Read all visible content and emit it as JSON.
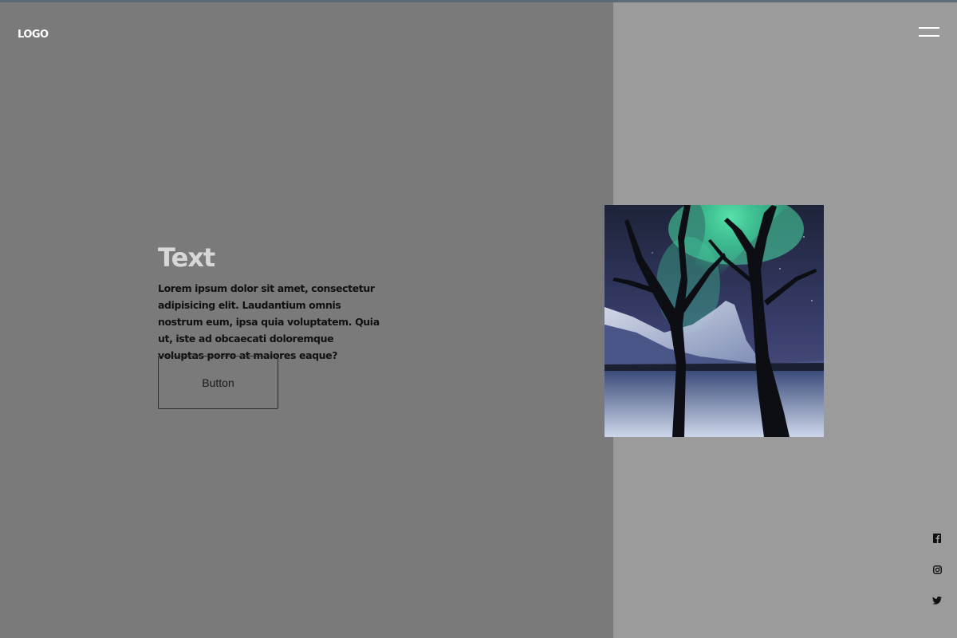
{
  "header": {
    "logo": "LOGO",
    "menu_icon": "hamburger-menu-icon"
  },
  "hero": {
    "title": "Text",
    "body": "Lorem ipsum dolor sit amet, consectetur adipisicing elit. Laudantium omnis nostrum eum, ipsa quia voluptatem. Quia ut, iste ad obcaecati doloremque voluptas porro at maiores eaque?",
    "button_label": "Button"
  },
  "image": {
    "subject": "aurora-over-snowy-mountains-with-bare-trees"
  },
  "social": {
    "icons": [
      "facebook-icon",
      "instagram-icon",
      "twitter-icon"
    ]
  },
  "colors": {
    "left_panel": "#7a7a7a",
    "right_panel": "#9b9b9b",
    "top_border": "#5f6b73",
    "title": "#d7d7d7",
    "body_text": "#111111",
    "aurora": "#46e0a4"
  }
}
